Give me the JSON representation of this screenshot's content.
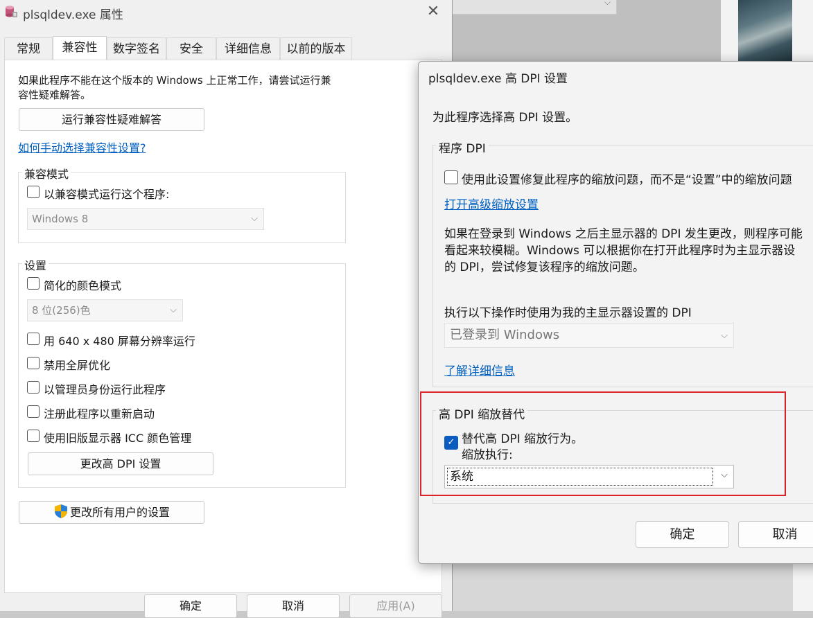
{
  "properties_dialog": {
    "title": "plsqldev.exe 属性",
    "tabs": [
      {
        "label": "常规"
      },
      {
        "label": "兼容性"
      },
      {
        "label": "数字签名"
      },
      {
        "label": "安全"
      },
      {
        "label": "详细信息"
      },
      {
        "label": "以前的版本"
      }
    ],
    "intro_text_line1": "如果此程序不能在这个版本的 Windows 上正常工作，请尝试运行兼",
    "intro_text_line2": "容性疑难解答。",
    "run_troubleshooter_button": "运行兼容性疑难解答",
    "manual_link": "如何手动选择兼容性设置?",
    "compat_mode": {
      "group_label": "兼容模式",
      "checkbox_label": "以兼容模式运行这个程序:",
      "os_select_value": "Windows 8"
    },
    "settings": {
      "group_label": "设置",
      "reduced_color_label": "简化的颜色模式",
      "color_select_value": "8 位(256)色",
      "res_640_label": "用 640 x 480 屏幕分辨率运行",
      "disable_fullscreen_label": "禁用全屏优化",
      "run_as_admin_label": "以管理员身份运行此程序",
      "register_restart_label": "注册此程序以重新启动",
      "legacy_icc_label": "使用旧版显示器 ICC 颜色管理",
      "change_dpi_button": "更改高 DPI 设置"
    },
    "change_all_users_button": "更改所有用户的设置",
    "footer": {
      "ok": "确定",
      "cancel": "取消",
      "apply": "应用(A)"
    }
  },
  "dpi_dialog": {
    "title": "plsqldev.exe 高 DPI 设置",
    "heading": "为此程序选择高 DPI 设置。",
    "program_dpi": {
      "group_label": "程序 DPI",
      "checkbox_label": "使用此设置修复此程序的缩放问题，而不是“设置”中的缩放问题",
      "advanced_link": "打开高级缩放设置",
      "desc_line1": "如果在登录到 Windows 之后主显示器的 DPI 发生更改，则程序可能",
      "desc_line2": "看起来较模糊。Windows 可以根据你在打开此程序时为主显示器设",
      "desc_line3": "的 DPI，尝试修复该程序的缩放问题。",
      "use_dpi_label": "执行以下操作时使用为我的主显示器设置的 DPI",
      "dpi_select_value": "已登录到 Windows",
      "learn_more_link": "了解详细信息"
    },
    "override": {
      "group_label": "高 DPI 缩放替代",
      "checkbox_label": "替代高 DPI 缩放行为。",
      "performed_by_label": "缩放执行:",
      "scaling_select_value": "系统"
    },
    "footer": {
      "ok": "确定",
      "cancel": "取消"
    }
  },
  "colors": {
    "accent": "#0a5cbf",
    "highlight_box": "#d8232a",
    "link": "#0060c0"
  }
}
